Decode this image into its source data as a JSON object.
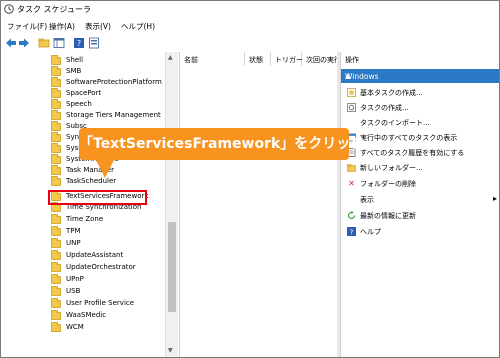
{
  "window": {
    "title": "タスク スケジューラ"
  },
  "menu": [
    "ファイル(F)",
    "操作(A)",
    "表示(V)",
    "ヘルプ(H)"
  ],
  "tree": {
    "items": [
      "Shell",
      "SMB",
      "SoftwareProtectionPlatform",
      "SpacePort",
      "Speech",
      "Storage Tiers Management",
      "Subsc",
      "Sync",
      "Sysm",
      "SystemRestore",
      "Task Manager",
      "TaskScheduler",
      "TextServicesFramework",
      "Time Synchronization",
      "Time Zone",
      "TPM",
      "UNP",
      "UpdateAssistant",
      "UpdateOrchestrator",
      "UPnP",
      "USB",
      "User Profile Service",
      "WaaSMedic",
      "WCM"
    ]
  },
  "middle": {
    "columns": [
      "名前",
      "状態",
      "トリガー",
      "次回の実行"
    ]
  },
  "actions": {
    "header": "操作",
    "section": "Windows",
    "items": [
      "基本タスクの作成...",
      "タスクの作成...",
      "タスクのインポート...",
      "実行中のすべてのタスクの表示",
      "すべてのタスク履歴を有効にする",
      "新しいフォルダー...",
      "フォルダーの削除",
      "表示",
      "最新の情報に更新",
      "ヘルプ"
    ]
  },
  "callout": {
    "text": "「TextServicesFramework」をクリック"
  },
  "colors": {
    "accent": "#2b79c4",
    "callout": "#f7931e",
    "highlight": "#e60012"
  }
}
